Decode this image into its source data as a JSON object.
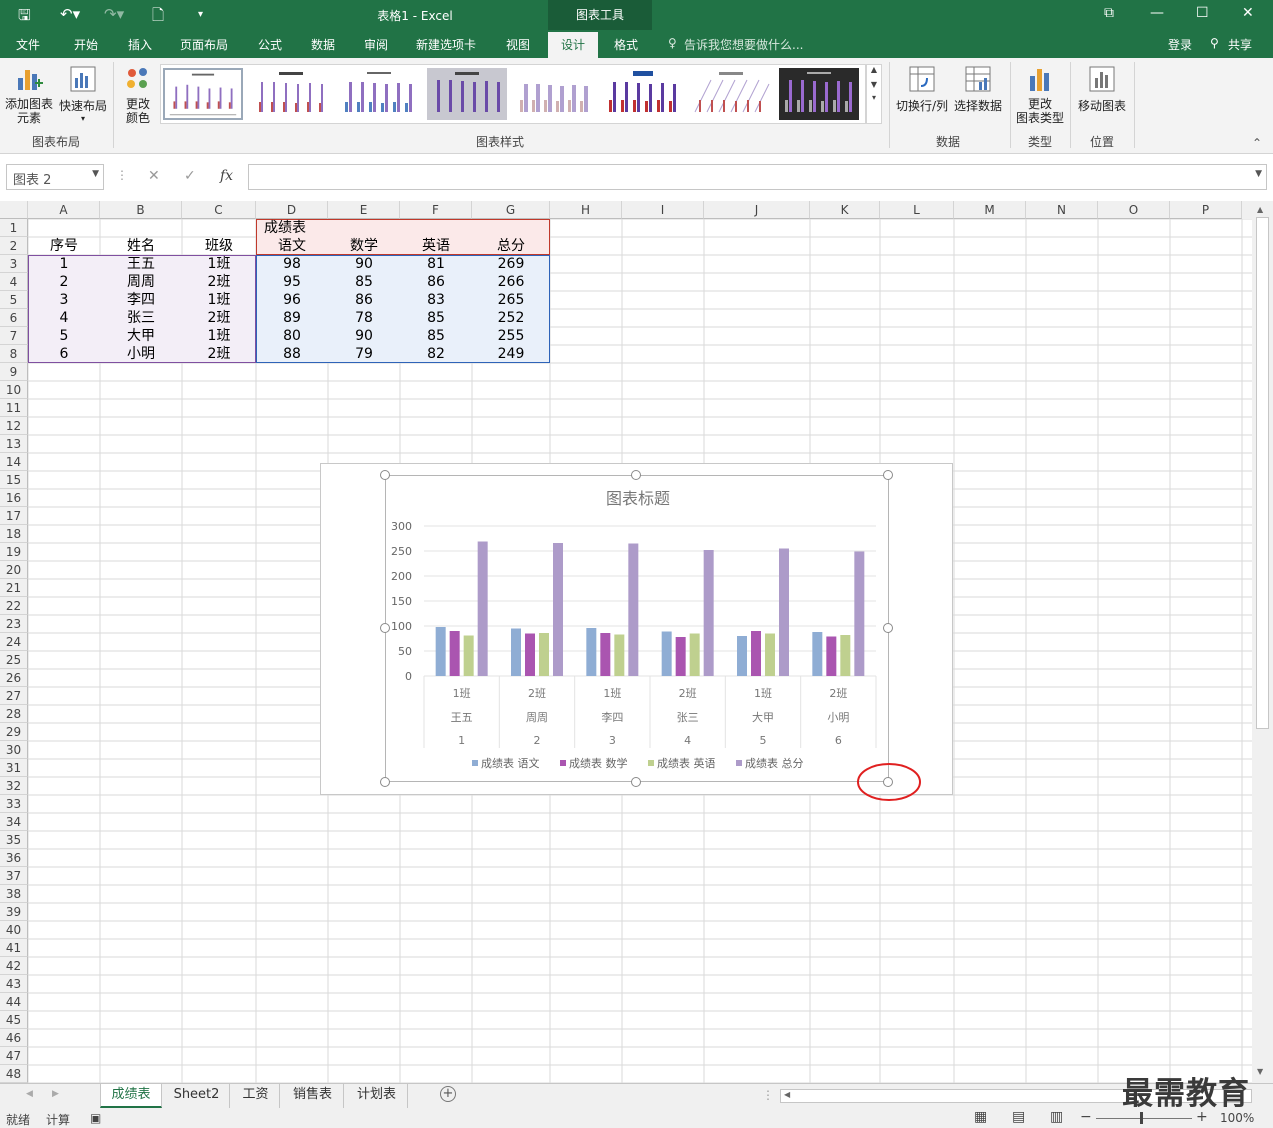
{
  "window": {
    "title": "表格1 - Excel",
    "context_tab": "图表工具"
  },
  "menu": {
    "file": "文件",
    "home": "开始",
    "insert": "插入",
    "page_layout": "页面布局",
    "formulas": "公式",
    "data": "数据",
    "review": "审阅",
    "new_tab": "新建选项卡",
    "view": "视图",
    "design": "设计",
    "format": "格式",
    "tell_me": "告诉我您想要做什么...",
    "login": "登录",
    "share": "共享"
  },
  "ribbon": {
    "add_element": "添加图表\n元素",
    "quick_layout": "快速布局",
    "change_colors": "更改\n颜色",
    "group_layout": "图表布局",
    "group_styles": "图表样式",
    "switch_row_col": "切换行/列",
    "select_data": "选择数据",
    "group_data": "数据",
    "change_type": "更改\n图表类型",
    "group_type": "类型",
    "move_chart": "移动图表",
    "group_location": "位置"
  },
  "formula_bar": {
    "name_box": "图表 2",
    "fx": "fx",
    "value": ""
  },
  "columns": [
    "A",
    "B",
    "C",
    "D",
    "E",
    "F",
    "G",
    "H",
    "I",
    "J",
    "K",
    "L",
    "M",
    "N",
    "O",
    "P"
  ],
  "sheet": {
    "title": "成绩表",
    "headers": [
      "序号",
      "姓名",
      "班级",
      "语文",
      "数学",
      "英语",
      "总分"
    ],
    "rows": [
      [
        "1",
        "王五",
        "1班",
        "98",
        "90",
        "81",
        "269"
      ],
      [
        "2",
        "周周",
        "2班",
        "95",
        "85",
        "86",
        "266"
      ],
      [
        "3",
        "李四",
        "1班",
        "96",
        "86",
        "83",
        "265"
      ],
      [
        "4",
        "张三",
        "2班",
        "89",
        "78",
        "85",
        "252"
      ],
      [
        "5",
        "大甲",
        "1班",
        "80",
        "90",
        "85",
        "255"
      ],
      [
        "6",
        "小明",
        "2班",
        "88",
        "79",
        "82",
        "249"
      ]
    ]
  },
  "chart_data": {
    "type": "bar",
    "title": "图表标题",
    "categories": [
      [
        "1班",
        "王五",
        "1"
      ],
      [
        "2班",
        "周周",
        "2"
      ],
      [
        "1班",
        "李四",
        "3"
      ],
      [
        "2班",
        "张三",
        "4"
      ],
      [
        "1班",
        "大甲",
        "5"
      ],
      [
        "2班",
        "小明",
        "6"
      ]
    ],
    "series": [
      {
        "name": "成绩表 语文",
        "color": "#8fadd4",
        "values": [
          98,
          95,
          96,
          89,
          80,
          88
        ]
      },
      {
        "name": "成绩表 数学",
        "color": "#aa55b0",
        "values": [
          90,
          85,
          86,
          78,
          90,
          79
        ]
      },
      {
        "name": "成绩表 英语",
        "color": "#bfd08f",
        "values": [
          81,
          86,
          83,
          85,
          85,
          82
        ]
      },
      {
        "name": "成绩表 总分",
        "color": "#ad9bc9",
        "values": [
          269,
          266,
          265,
          252,
          255,
          249
        ]
      }
    ],
    "yticks": [
      "0",
      "50",
      "100",
      "150",
      "200",
      "250",
      "300"
    ],
    "ylim": [
      0,
      300
    ],
    "grid": true,
    "legend": "bottom"
  },
  "sheet_tabs": [
    "成绩表",
    "Sheet2",
    "工资",
    "销售表",
    "计划表"
  ],
  "status": {
    "ready": "就绪",
    "calc": "计算",
    "zoom": "100%"
  },
  "watermark": "最需教育"
}
